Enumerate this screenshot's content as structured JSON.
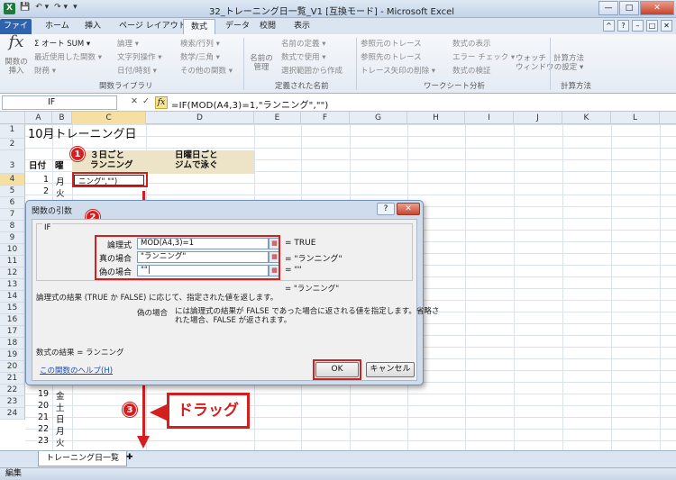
{
  "window": {
    "title": "32_トレーニング日一覧_V1 [互換モード] - Microsoft Excel",
    "logo": "X",
    "controls": [
      "—",
      "□",
      "✕"
    ]
  },
  "quick_access": [
    "💾",
    "↶ ▾",
    "↷ ▾",
    "▾"
  ],
  "ribbon_tabs": [
    "ファイル",
    "ホーム",
    "挿入",
    "ページ レイアウト",
    "数式",
    "データ",
    "校閲",
    "表示"
  ],
  "ribbon_tab_active": "数式",
  "ribbon": {
    "insert_function": "関数の\n挿入",
    "autosum": "Σ オート SUM ▾",
    "recent": "最近使用した関数 ▾",
    "financial": "財務 ▾",
    "logical": "論理 ▾",
    "text": "文字列操作 ▾",
    "datetime": "日付/時刻 ▾",
    "lookup": "検索/行列 ▾",
    "math": "数学/三角 ▾",
    "more": "その他の関数 ▾",
    "group_library": "関数ライブラリ",
    "name_manager": "名前の\n管理",
    "define_name": "名前の定義 ▾",
    "use_in_formula": "数式で使用 ▾",
    "create_from_selection": "選択範囲から作成",
    "group_names": "定義された名前",
    "trace_precedents": "参照元のトレース",
    "trace_dependents": "参照先のトレース",
    "remove_arrows": "トレース矢印の削除 ▾",
    "show_formulas": "数式の表示",
    "error_checking": "エラー チェック ▾",
    "evaluate_formula": "数式の検証",
    "watch_window": "ウォッチ\nウィンドウ",
    "group_audit": "ワークシート分析",
    "calc_options": "計算方法\nの設定 ▾",
    "group_calc": "計算方法"
  },
  "formula_bar": {
    "name_box": "IF",
    "cancel": "✕",
    "enter": "✓",
    "fx": "fx",
    "formula": "=IF(MOD(A4,3)=1,\"ランニング\",\"\")"
  },
  "columns": [
    "A",
    "B",
    "C",
    "D",
    "E",
    "F",
    "G",
    "H",
    "I",
    "J",
    "K",
    "L"
  ],
  "rows": [
    "1",
    "2",
    "3",
    "4",
    "5",
    "6",
    "7",
    "8",
    "9",
    "10",
    "11",
    "12",
    "13",
    "14",
    "15",
    "16",
    "17",
    "18",
    "19",
    "20",
    "21",
    "22",
    "23",
    "24"
  ],
  "sheet": {
    "title": "10月トレーニング日",
    "header_date": "日付",
    "header_day": "曜",
    "header_c": "３日ごと\nランニング",
    "header_d": "日曜日ごと\nジムで泳ぐ",
    "c4_edit": "ニング\",\"\")",
    "rows": [
      {
        "date": "1",
        "day": "月"
      },
      {
        "date": "2",
        "day": "火"
      },
      {
        "date": "19",
        "day": "金"
      },
      {
        "date": "20",
        "day": "土"
      },
      {
        "date": "21",
        "day": "日"
      },
      {
        "date": "22",
        "day": "月"
      },
      {
        "date": "23",
        "day": "火"
      }
    ],
    "tab_name": "トレーニング日一覧"
  },
  "status": "編集",
  "dialog": {
    "title": "関数の引数",
    "help_btn": "?",
    "close_btn": "✕",
    "function": "IF",
    "args": [
      {
        "label": "論理式",
        "value": "MOD(A4,3)=1",
        "result": "=  TRUE"
      },
      {
        "label": "真の場合",
        "value": "\"ランニング\"",
        "result": "=  \"ランニング\""
      },
      {
        "label": "偽の場合",
        "value": "\"\"|",
        "result": "=  \"\""
      }
    ],
    "overall_result": "=  \"ランニング\"",
    "description": "論理式の結果 (TRUE か FALSE) に応じて、指定された値を返します。",
    "arg_desc_name": "偽の場合",
    "arg_desc": "には論理式の結果が FALSE であった場合に返される値を指定します。省略さ\nれた場合、FALSE が返されます。",
    "formula_result": "数式の結果 =  ランニング",
    "help_link": "この関数のヘルプ(H)",
    "ok": "OK",
    "cancel": "キャンセル"
  },
  "annotations": {
    "step1": "1",
    "step2": "2",
    "step3": "3",
    "drag_label": "ドラッグ",
    "accent_color": "#d41f1f"
  }
}
